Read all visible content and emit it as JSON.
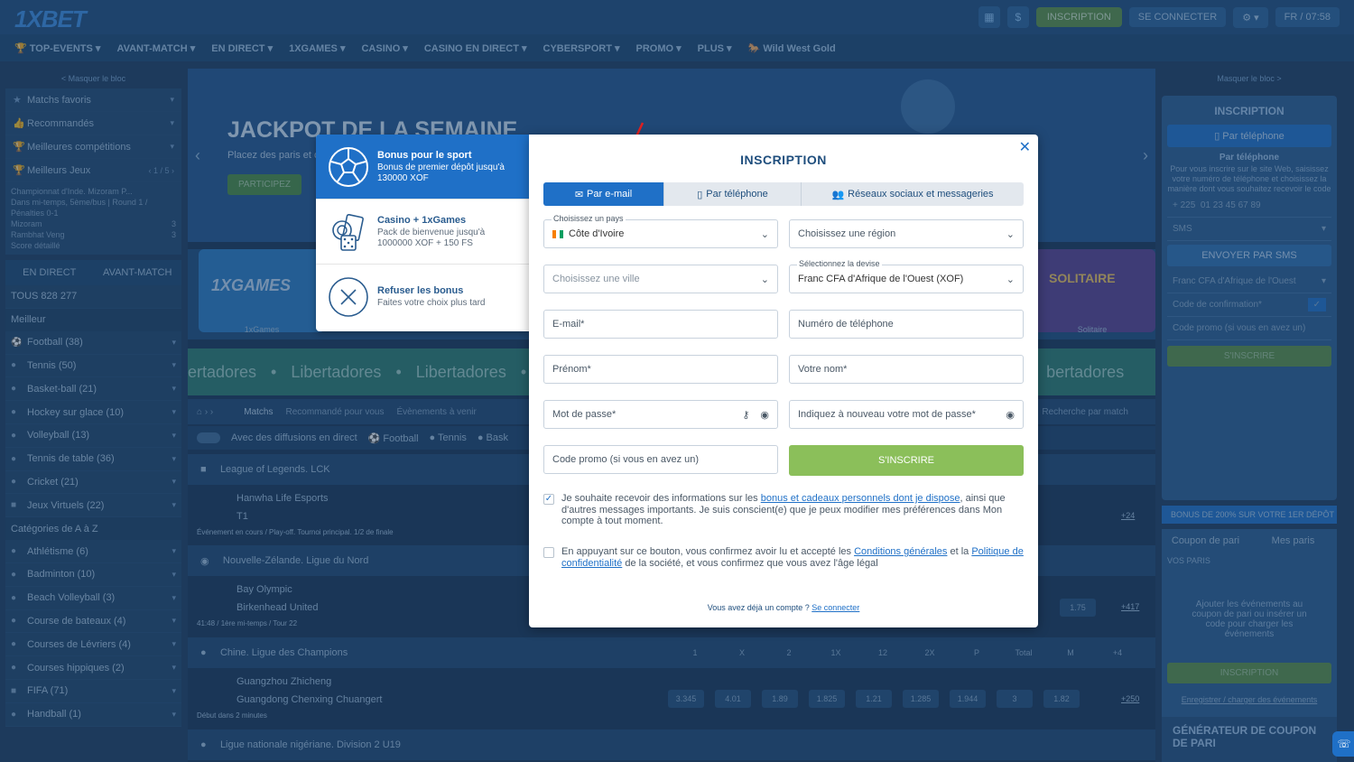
{
  "header": {
    "logo": "1XBET",
    "register_btn": "INSCRIPTION",
    "login_btn": "SE CONNECTER",
    "lang": "FR / 07:58"
  },
  "nav": [
    "TOP-EVENTS",
    "AVANT-MATCH",
    "EN DIRECT",
    "1XGAMES",
    "CASINO",
    "CASINO EN DIRECT",
    "CYBERSPORT",
    "PROMO",
    "PLUS",
    "Wild West Gold"
  ],
  "left": {
    "hide": "< Masquer le bloc",
    "items": [
      "Matchs favoris",
      "Recommandés",
      "Meilleures compétitions",
      "Meilleurs Jeux"
    ],
    "pager": "1 / 5",
    "mini": {
      "league": "Championnat d'Inde. Mizoram P...",
      "status": "Dans mi-temps, 5ème/bus | Round 1 / Pénalties 0-1",
      "team1": "Mizoram",
      "team2": "Rambhat Veng",
      "score1": "3",
      "score2": "3",
      "detail": "Score détaillé"
    },
    "tabs": [
      "EN DIRECT",
      "AVANT-MATCH"
    ],
    "all": "TOUS 828",
    "all_count": "277",
    "best": "Meilleur",
    "sports": [
      "Football (38)",
      "Tennis (50)",
      "Basket-ball (21)",
      "Hockey sur glace (10)",
      "Volleyball (13)",
      "Tennis de table (36)",
      "Cricket (21)",
      "Jeux Virtuels (22)"
    ],
    "cat": "Catégories de A à Z",
    "sports2": [
      "Athlétisme (6)",
      "Badminton (10)",
      "Beach Volleyball (3)",
      "Course de bateaux (4)",
      "Courses de Lévriers (4)",
      "Courses hippiques (2)",
      "FIFA (71)",
      "Handball (1)"
    ]
  },
  "main": {
    "jackpot": "JACKPOT DE LA SEMAINE",
    "sub": "Placez des paris et c",
    "btn": "PARTICIPEZ",
    "games": [
      "1xGames",
      "Solitaire"
    ],
    "libs": [
      "ertadores",
      "Libertadores",
      "Libertadores",
      "bertadores"
    ],
    "tabs": [
      "Matchs",
      "Recommandé pour vous",
      "Évènements à venir",
      "Recherche par match"
    ],
    "toggle": "Avec des diffusions en direct",
    "toggle_sports": [
      "Football",
      "Tennis",
      "Bask"
    ],
    "rows": [
      {
        "league": "League of Legends. LCK",
        "team1": "Hanwha Life Esports",
        "team2": "T1",
        "info": "Événement en cours / Play-off. Tournoi principal. 1/2 de finale",
        "plus": "+24"
      },
      {
        "league": "Nouvelle-Zélande. Ligue du Nord",
        "team1": "Bay Olympic",
        "team2": "Birkenhead United",
        "info": "41:48 / 1ère mi-temps / Tour 22",
        "odd": "1.75",
        "plus": "+417"
      },
      {
        "league": "Chine. Ligue des Champions",
        "team1": "Guangzhou Zhicheng",
        "team2": "Guangdong Chenxing Chuangert",
        "info": "Début dans 2 minutes",
        "odds": [
          "3.345",
          "4.01",
          "1.89",
          "1.825",
          "1.21",
          "1.285",
          "1.944",
          "3",
          "1.82"
        ],
        "plus": "+250"
      },
      {
        "league": "Ligue nationale nigériane. Division 2 U19"
      }
    ],
    "cols": [
      "1",
      "X",
      "2",
      "1X",
      "12",
      "2X",
      "P",
      "Total",
      "M",
      "+4"
    ]
  },
  "right": {
    "hide": "Masquer le bloc >",
    "title": "INSCRIPTION",
    "phone_btn": "Par téléphone",
    "phone_title": "Par téléphone",
    "phone_txt": "Pour vous inscrire sur le site Web, saisissez votre numéro de téléphone et choisissez la manière dont vous souhaitez recevoir le code",
    "phone_prefix": "+ 225",
    "phone_ph": "01 23 45 67 89",
    "sms": "SMS",
    "send_sms": "ENVOYER PAR SMS",
    "currency": "Franc CFA d'Afrique de l'Ouest",
    "conf_code": "Code de confirmation*",
    "promo": "Code promo (si vous en avez un)",
    "signup": "S'INSCRIRE",
    "bonus": "BONUS DE 200% SUR VOTRE 1ER DÉPÔT",
    "coupon_tabs": [
      "Coupon de pari",
      "Mes paris"
    ],
    "your_bets": "VOS PARIS",
    "coupon_txt": "Ajouter les événements au coupon de pari ou insérer un code pour charger les événements",
    "insc2": "INSCRIPTION",
    "save": "Enregistrer / charger des événements",
    "gen": "GÉNÉRATEUR DE COUPON DE PARI"
  },
  "bonus_panel": [
    {
      "title": "Bonus pour le sport",
      "sub": "Bonus de premier dépôt jusqu'à 130000 XOF",
      "icon": "soccer-ball-icon"
    },
    {
      "title": "Casino + 1xGames",
      "sub": "Pack de bienvenue jusqu'à 1000000 XOF + 150 FS",
      "icon": "dice-cards-icon"
    },
    {
      "title": "Refuser les bonus",
      "sub": "Faites votre choix plus tard",
      "icon": "x-circle-icon"
    }
  ],
  "modal": {
    "title": "INSCRIPTION",
    "tabs": [
      "Par e-mail",
      "Par téléphone",
      "Réseaux sociaux et messageries"
    ],
    "country_label": "Choisissez un pays",
    "country": "Côte d'Ivoire",
    "region_ph": "Choisissez une région",
    "city_ph": "Choisissez une ville",
    "currency_label": "Sélectionnez la devise",
    "currency": "Franc CFA d'Afrique de l'Ouest (XOF)",
    "email_ph": "E-mail*",
    "phone_ph": "Numéro de téléphone",
    "firstname_ph": "Prénom*",
    "lastname_ph": "Votre nom*",
    "password_ph": "Mot de passe*",
    "password2_ph": "Indiquez à nouveau votre mot de passe*",
    "promo_ph": "Code promo (si vous en avez un)",
    "submit": "S'INSCRIRE",
    "consent1_a": "Je souhaite recevoir des informations sur les ",
    "consent1_link": "bonus et cadeaux personnels dont je dispose",
    "consent1_b": ", ainsi que d'autres messages importants. Je suis conscient(e) que je peux modifier mes préférences dans Mon compte à tout moment.",
    "consent2_a": "En appuyant sur ce bouton, vous confirmez avoir lu et accepté les ",
    "consent2_link1": "Conditions générales",
    "consent2_b": " et la ",
    "consent2_link2": "Politique de confidentialité",
    "consent2_c": " de la société, et vous confirmez que vous avez l'âge légal",
    "foot": "Vous avez déjà un compte ? ",
    "foot_link": "Se connecter"
  }
}
